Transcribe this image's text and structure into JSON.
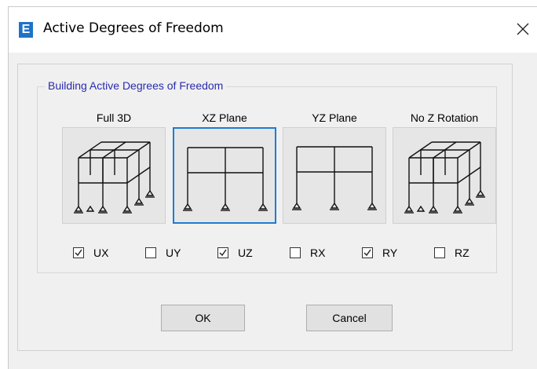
{
  "window": {
    "app_icon_letter": "E",
    "title": "Active Degrees of Freedom",
    "close_glyph": "×"
  },
  "group": {
    "title": "Building Active Degrees of Freedom"
  },
  "planes": [
    {
      "label": "Full 3D",
      "icon": "frame-3d-icon",
      "selected": false
    },
    {
      "label": "XZ Plane",
      "icon": "frame-xz-icon",
      "selected": true
    },
    {
      "label": "YZ Plane",
      "icon": "frame-yz-icon",
      "selected": false
    },
    {
      "label": "No Z Rotation",
      "icon": "frame-3d-icon",
      "selected": false
    }
  ],
  "dofs": [
    {
      "label": "UX",
      "checked": true
    },
    {
      "label": "UY",
      "checked": false
    },
    {
      "label": "UZ",
      "checked": true
    },
    {
      "label": "RX",
      "checked": false
    },
    {
      "label": "RY",
      "checked": true
    },
    {
      "label": "RZ",
      "checked": false
    }
  ],
  "buttons": {
    "ok": "OK",
    "cancel": "Cancel"
  },
  "colors": {
    "legend_text": "#2a2ab0",
    "selected_border": "#1c7cd5",
    "app_icon": "#1e73c8"
  }
}
